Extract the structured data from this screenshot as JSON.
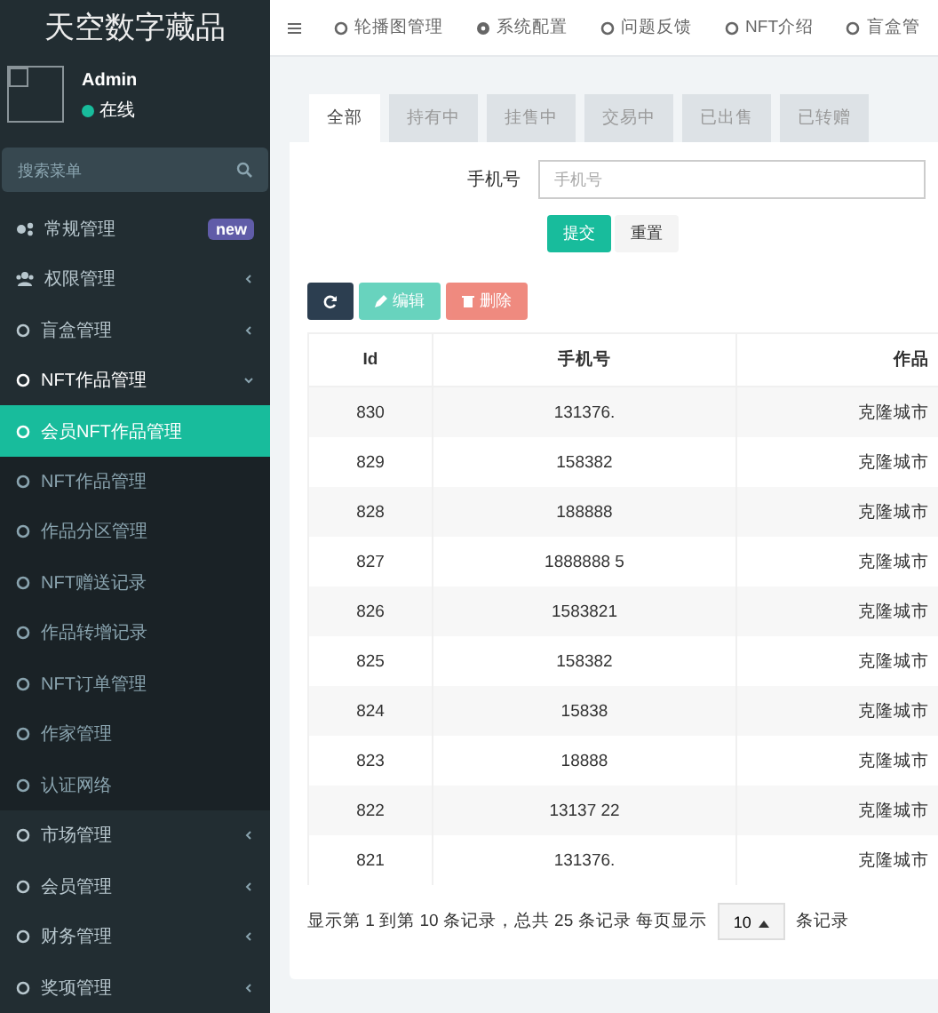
{
  "sidebar": {
    "brand": "天空数字藏品",
    "user": {
      "name": "Admin",
      "status": "在线"
    },
    "search": {
      "placeholder": "搜索菜单"
    },
    "items": [
      {
        "label": "常规管理",
        "kind": "gears",
        "badge": "new",
        "expanded": false,
        "selected": false
      },
      {
        "label": "权限管理",
        "kind": "users",
        "expanded": false,
        "selected": false
      },
      {
        "label": "盲盒管理",
        "kind": "circle",
        "expanded": false,
        "selected": false
      },
      {
        "label": "NFT作品管理",
        "kind": "circle",
        "expanded": true,
        "selected": false,
        "children": [
          {
            "label": "会员NFT作品管理",
            "selected": true
          },
          {
            "label": "NFT作品管理",
            "selected": false
          },
          {
            "label": "作品分区管理",
            "selected": false
          },
          {
            "label": "NFT赠送记录",
            "selected": false
          },
          {
            "label": "作品转增记录",
            "selected": false
          },
          {
            "label": "NFT订单管理",
            "selected": false
          },
          {
            "label": "作家管理",
            "selected": false
          },
          {
            "label": "认证网络",
            "selected": false
          }
        ]
      },
      {
        "label": "市场管理",
        "kind": "circle",
        "expanded": false,
        "selected": false
      },
      {
        "label": "会员管理",
        "kind": "circle",
        "expanded": false,
        "selected": false
      },
      {
        "label": "财务管理",
        "kind": "circle",
        "expanded": false,
        "selected": false
      },
      {
        "label": "奖项管理",
        "kind": "circle",
        "expanded": false,
        "selected": false
      }
    ]
  },
  "topnav": [
    {
      "label": "轮播图管理",
      "kind": "circle"
    },
    {
      "label": "系统配置",
      "kind": "gear"
    },
    {
      "label": "问题反馈",
      "kind": "circle"
    },
    {
      "label": "NFT介绍",
      "kind": "circle"
    },
    {
      "label": "盲盒管",
      "kind": "circle"
    }
  ],
  "tabs": [
    {
      "label": "全部",
      "selected": true
    },
    {
      "label": "持有中",
      "selected": false
    },
    {
      "label": "挂售中",
      "selected": false
    },
    {
      "label": "交易中",
      "selected": false
    },
    {
      "label": "已出售",
      "selected": false
    },
    {
      "label": "已转赠",
      "selected": false
    }
  ],
  "form": {
    "label": "手机号",
    "placeholder": "手机号",
    "submit": "提交",
    "reset": "重置"
  },
  "toolbar": [
    {
      "kind": "refresh",
      "disabled": false
    },
    {
      "kind": "edit",
      "label": "编辑",
      "disabled": true
    },
    {
      "kind": "delete",
      "label": "删除",
      "disabled": true
    }
  ],
  "table": {
    "columns": [
      "Id",
      "手机号",
      "作品"
    ],
    "rows": [
      [
        "830",
        "131376.",
        "克隆城市"
      ],
      [
        "829",
        "158382",
        "克隆城市"
      ],
      [
        "828",
        "188888",
        "克隆城市"
      ],
      [
        "827",
        "1888888 5",
        "克隆城市"
      ],
      [
        "826",
        "1583821",
        "克隆城市"
      ],
      [
        "825",
        "158382",
        "克隆城市"
      ],
      [
        "824",
        "15838",
        "克隆城市"
      ],
      [
        "823",
        "18888",
        "克隆城市"
      ],
      [
        "822",
        "13137 22",
        "克隆城市"
      ],
      [
        "821",
        "131376.",
        "克隆城市"
      ]
    ]
  },
  "pagination": {
    "summary": "显示第 1 到第 10 条记录，总共 25 条记录 每页显示",
    "page_size": "10",
    "suffix": "条记录"
  }
}
